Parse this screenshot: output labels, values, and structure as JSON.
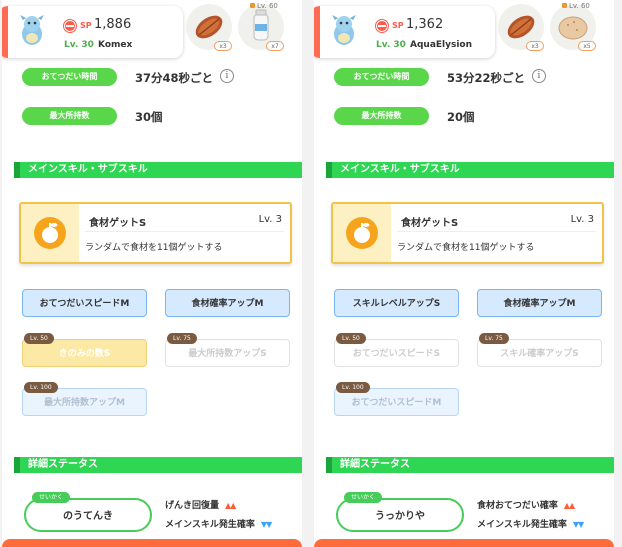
{
  "panels": [
    {
      "sp_label": "SP",
      "sp_value": "1,886",
      "level": "Lv. 30",
      "name": "Komex",
      "ingredients": [
        {
          "icon": "cacao-icon",
          "count": "x3"
        },
        {
          "icon": "milk-icon",
          "count": "x7",
          "lock": "Lv. 60"
        }
      ],
      "help_time_label": "おてつだい時間",
      "help_time": "37分48秒ごと",
      "max_carry_label": "最大所持数",
      "max_carry": "30個",
      "skill_section": "メインスキル・サブスキル",
      "main_skill": {
        "name": "食材ゲットS",
        "level": "Lv. 3",
        "desc": "ランダムで食材を11個ゲットする"
      },
      "sub_skills": [
        {
          "label": "おてつだいスピードM",
          "style": "blue"
        },
        {
          "label": "食材確率アップM",
          "style": "blue"
        },
        {
          "label": "きのみの数S",
          "style": "gold",
          "lv": "Lv. 50"
        },
        {
          "label": "最大所持数アップS",
          "style": "grey",
          "lv": "Lv. 75"
        },
        {
          "label": "最大所持数アップM",
          "style": "lightblue",
          "lv": "Lv. 100"
        }
      ],
      "detail_section": "詳細ステータス",
      "nature_tag": "せいかく",
      "nature": "のうてんき",
      "effects": [
        {
          "label": "げんき回復量",
          "dir": "up",
          "arrows": "▲▲"
        },
        {
          "label": "メインスキル発生確率",
          "dir": "down",
          "arrows": "▼▼"
        }
      ]
    },
    {
      "sp_label": "SP",
      "sp_value": "1,362",
      "level": "Lv. 30",
      "name": "AquaElysion",
      "ingredients": [
        {
          "icon": "cacao-icon",
          "count": "x3"
        },
        {
          "icon": "potato-icon",
          "count": "x5",
          "lock": "Lv. 60"
        }
      ],
      "help_time_label": "おてつだい時間",
      "help_time": "53分22秒ごと",
      "max_carry_label": "最大所持数",
      "max_carry": "20個",
      "skill_section": "メインスキル・サブスキル",
      "main_skill": {
        "name": "食材ゲットS",
        "level": "Lv. 3",
        "desc": "ランダムで食材を11個ゲットする"
      },
      "sub_skills": [
        {
          "label": "スキルレベルアップS",
          "style": "blue"
        },
        {
          "label": "食材確率アップM",
          "style": "blue"
        },
        {
          "label": "おてつだいスピードS",
          "style": "grey",
          "lv": "Lv. 50"
        },
        {
          "label": "スキル確率アップS",
          "style": "grey",
          "lv": "Lv. 75"
        },
        {
          "label": "おてつだいスピードM",
          "style": "lightblue",
          "lv": "Lv. 100"
        }
      ],
      "detail_section": "詳細ステータス",
      "nature_tag": "せいかく",
      "nature": "うっかりや",
      "effects": [
        {
          "label": "食材おてつだい確率",
          "dir": "up",
          "arrows": "▲▲"
        },
        {
          "label": "メインスキル発生確率",
          "dir": "down",
          "arrows": "▼▼"
        }
      ]
    }
  ],
  "colors": {
    "accent_green": "#2fd654",
    "sp_red": "#ff5a4a",
    "skill_gold": "#f2c24a",
    "sub_blue": "#79b6ee"
  }
}
